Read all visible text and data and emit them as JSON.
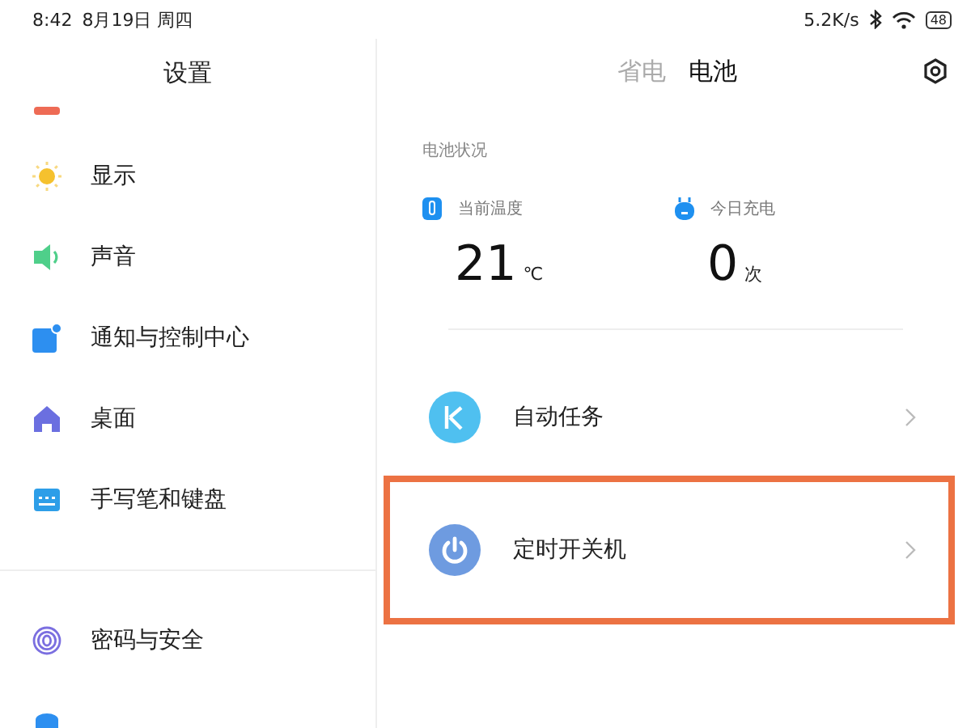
{
  "status_bar": {
    "time": "8:42",
    "date": "8月19日 周四",
    "net_speed": "5.2K/s",
    "battery": "48"
  },
  "sidebar": {
    "title": "设置",
    "items": [
      {
        "kind": "cut"
      },
      {
        "kind": "item",
        "label": "显示"
      },
      {
        "kind": "item",
        "label": "声音"
      },
      {
        "kind": "item",
        "label": "通知与控制中心"
      },
      {
        "kind": "item",
        "label": "桌面"
      },
      {
        "kind": "item",
        "label": "手写笔和键盘"
      },
      {
        "kind": "divider"
      },
      {
        "kind": "item",
        "label": "密码与安全"
      },
      {
        "kind": "cut"
      }
    ]
  },
  "tabs": [
    {
      "label": "省电",
      "selected": false
    },
    {
      "label": "电池",
      "selected": true
    }
  ],
  "battery_status": {
    "heading": "电池状况",
    "stats": [
      {
        "label": "当前温度",
        "value": "21",
        "unit": "℃"
      },
      {
        "label": "今日充电",
        "value": "0",
        "unit": "次"
      }
    ]
  },
  "options": [
    {
      "label": "自动任务",
      "highlighted": false
    },
    {
      "label": "定时开关机",
      "highlighted": true
    }
  ]
}
